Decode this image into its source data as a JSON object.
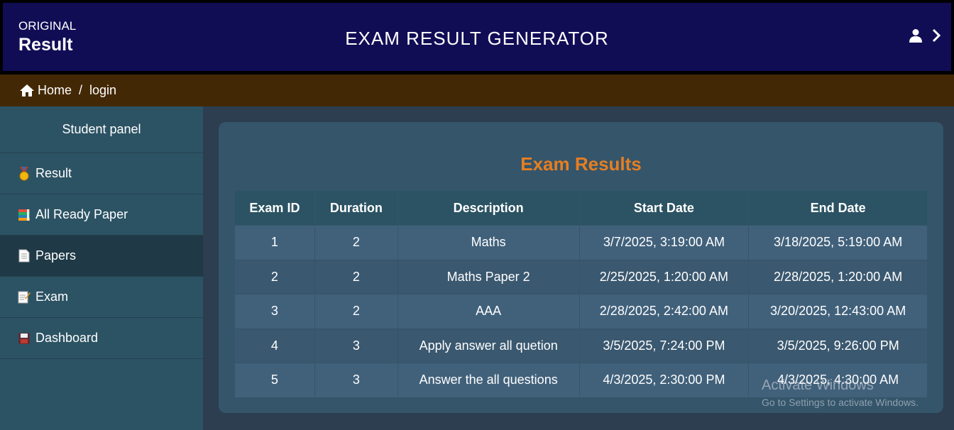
{
  "header": {
    "brand_small": "ORIGINAL",
    "brand_big": "Result",
    "title": "EXAM RESULT GENERATOR",
    "user_icon": "user-icon",
    "next_icon": "chevron-right-icon"
  },
  "breadcrumb": {
    "home_icon": "home-icon",
    "home": "Home",
    "separator": "/",
    "current": "login"
  },
  "sidebar": {
    "title": "Student panel",
    "items": [
      {
        "label": "Result",
        "icon": "medal-icon"
      },
      {
        "label": "All Ready Paper",
        "icon": "books-icon"
      },
      {
        "label": "Papers",
        "icon": "page-icon",
        "active": true
      },
      {
        "label": "Exam",
        "icon": "memo-icon"
      },
      {
        "label": "Dashboard",
        "icon": "floppy-disk-icon"
      }
    ]
  },
  "main": {
    "title": "Exam Results",
    "columns": [
      "Exam ID",
      "Duration",
      "Description",
      "Start Date",
      "End Date"
    ],
    "rows": [
      [
        "1",
        "2",
        "Maths",
        "3/7/2025, 3:19:00 AM",
        "3/18/2025, 5:19:00 AM"
      ],
      [
        "2",
        "2",
        "Maths Paper 2",
        "2/25/2025, 1:20:00 AM",
        "2/28/2025, 1:20:00 AM"
      ],
      [
        "3",
        "2",
        "AAA",
        "2/28/2025, 2:42:00 AM",
        "3/20/2025, 12:43:00 AM"
      ],
      [
        "4",
        "3",
        "Apply answer all quetion",
        "3/5/2025, 7:24:00 PM",
        "3/5/2025, 9:26:00 PM"
      ],
      [
        "5",
        "3",
        "Answer the all questions",
        "4/3/2025, 2:30:00 PM",
        "4/3/2025, 4:30:00 AM"
      ]
    ]
  },
  "watermark": {
    "title": "Activate Windows",
    "subtitle": "Go to Settings to activate Windows."
  },
  "colors": {
    "header_bg": "#110d55",
    "breadcrumb_bg": "#432805",
    "sidebar_bg": "#2c5364",
    "accent": "#e67e22"
  }
}
